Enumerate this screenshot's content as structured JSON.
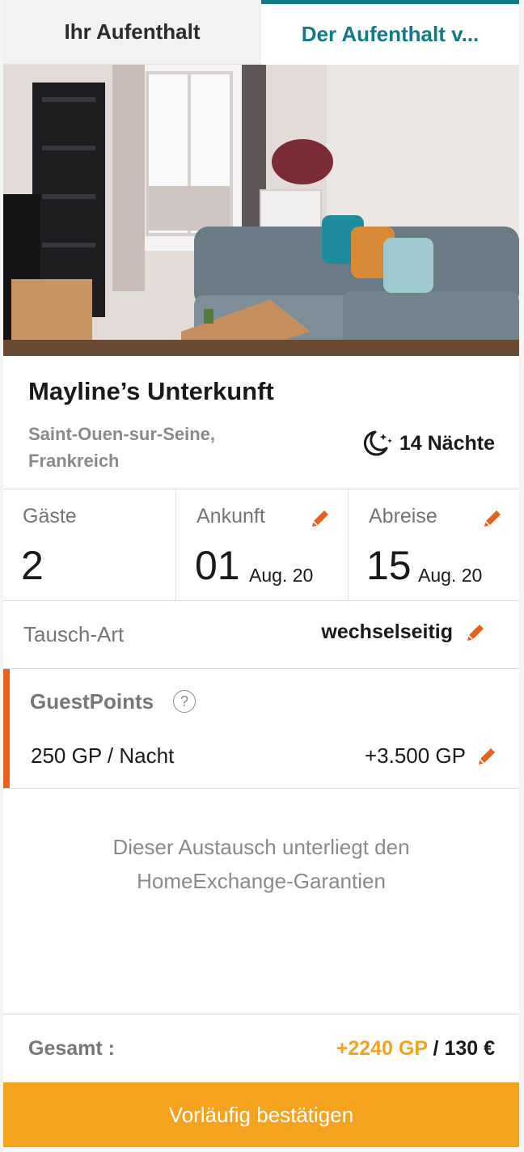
{
  "tabs": {
    "your_stay": "Ihr Aufenthalt",
    "their_stay": "Der Aufenthalt v..."
  },
  "listing": {
    "title": "Mayline’s Unterkunft",
    "location": "Saint-Ouen-sur-Seine, Frankreich",
    "nights": "14 Nächte",
    "nights_icon": "moon-stars-icon"
  },
  "stats": {
    "guests_label": "Gäste",
    "guests_value": "2",
    "arrival_label": "Ankunft",
    "arrival_day": "01",
    "arrival_month": "Aug. 20",
    "departure_label": "Abreise",
    "departure_day": "15",
    "departure_month": "Aug. 20"
  },
  "exchange": {
    "label": "Tausch-Art",
    "value": "wechselseitig"
  },
  "guestpoints": {
    "title": "GuestPoints",
    "help": "?",
    "rate": "250 GP / Nacht",
    "total": "+3.500 GP"
  },
  "guarantee": "Dieser Austausch unterliegt den HomeExchange-Garantien",
  "summary": {
    "label": "Gesamt :",
    "gp": "+2240 GP",
    "separator": " / ",
    "eur": "130 €"
  },
  "cta": "Vorläufig bestätigen",
  "colors": {
    "accent_teal": "#117a86",
    "accent_orange": "#f5a31e",
    "edit_orange": "#e8601c"
  }
}
